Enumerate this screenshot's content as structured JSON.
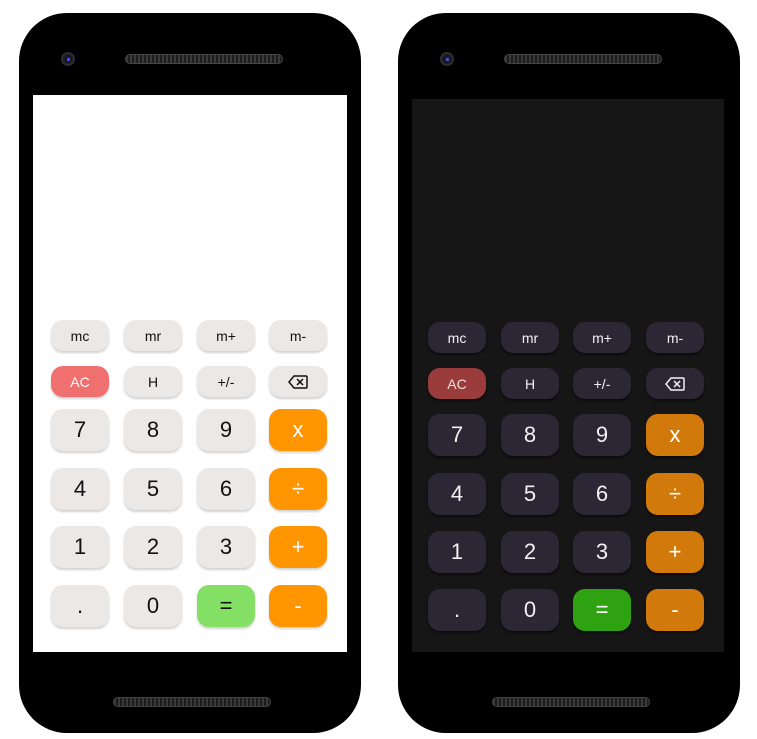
{
  "memory_keys": [
    "mc",
    "mr",
    "m+",
    "m-"
  ],
  "function_keys": [
    "AC",
    "H",
    "+/-",
    "backspace-icon"
  ],
  "rows": [
    [
      "7",
      "8",
      "9",
      "x"
    ],
    [
      "4",
      "5",
      "6",
      "÷"
    ],
    [
      "1",
      "2",
      "3",
      "+"
    ],
    [
      ".",
      "0",
      "=",
      "-"
    ]
  ],
  "light_theme": {
    "screen_bg": "#ffffff",
    "key_bg": "#ebe8e5",
    "ac_bg": "#f07070",
    "operator_bg": "#ff9500",
    "equals_bg": "#84e065"
  },
  "dark_theme": {
    "screen_bg": "#161616",
    "key_bg": "#2b2734",
    "ac_bg": "#9a3c3c",
    "operator_bg": "#d17a0b",
    "equals_bg": "#2fa212"
  }
}
